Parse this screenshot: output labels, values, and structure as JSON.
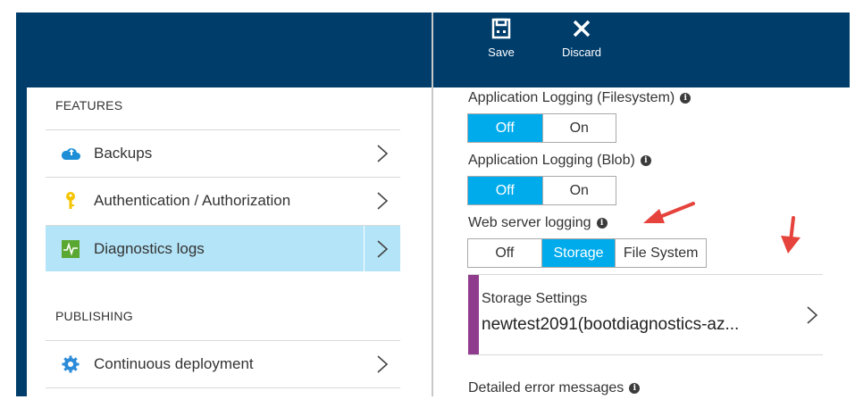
{
  "left_blade": {
    "features_title": "FEATURES",
    "features_items": [
      {
        "label": "Backups",
        "icon": "cloud-backup-icon"
      },
      {
        "label": "Authentication / Authorization",
        "icon": "key-icon"
      },
      {
        "label": "Diagnostics logs",
        "icon": "diagnostics-icon",
        "selected": true
      }
    ],
    "publishing_title": "PUBLISHING",
    "publishing_items": [
      {
        "label": "Continuous deployment",
        "icon": "gear-icon"
      }
    ]
  },
  "toolbar": {
    "save_label": "Save",
    "discard_label": "Discard"
  },
  "settings": {
    "app_logging_fs": {
      "label": "Application Logging (Filesystem)",
      "options": [
        "Off",
        "On"
      ],
      "selected": "Off"
    },
    "app_logging_blob": {
      "label": "Application Logging (Blob)",
      "options": [
        "Off",
        "On"
      ],
      "selected": "Off"
    },
    "web_server_logging": {
      "label": "Web server logging",
      "options": [
        "Off",
        "Storage",
        "File System"
      ],
      "selected": "Storage"
    },
    "storage_settings": {
      "title": "Storage Settings",
      "value": "newtest2091(bootdiagnostics-az..."
    },
    "detailed_errors": {
      "label": "Detailed error messages"
    }
  },
  "colors": {
    "header": "#003d6b",
    "accent": "#00abec",
    "selected_row": "#b4e4f7",
    "storage_bar": "#8f3c8f",
    "annotation_arrow": "#e5433b"
  }
}
